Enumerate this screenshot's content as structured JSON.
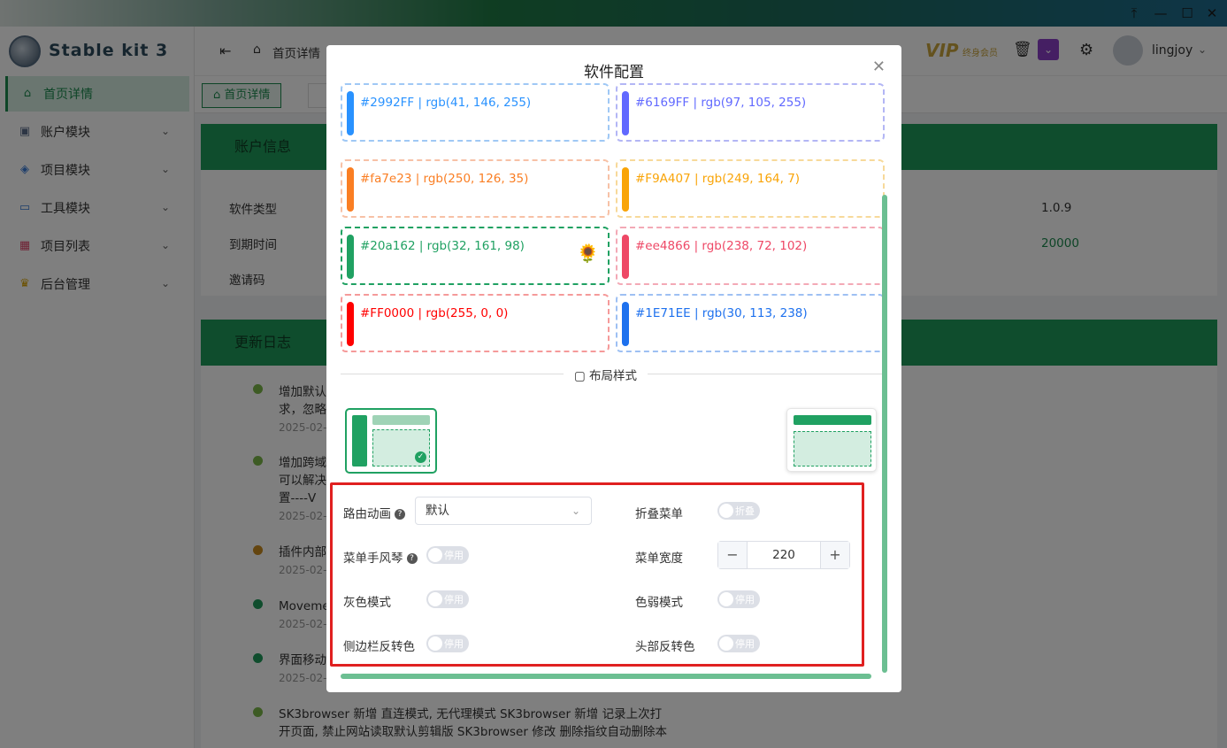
{
  "window": {
    "pin_icon": "pin-icon",
    "minimize_icon": "minimize-icon",
    "maximize_icon": "maximize-icon",
    "close_icon": "close-icon"
  },
  "app": {
    "title": "Stable kit 3"
  },
  "sidebar": {
    "items": [
      {
        "label": "首页详情",
        "icon": "home-icon"
      },
      {
        "label": "账户模块",
        "icon": "user-icon"
      },
      {
        "label": "项目模块",
        "icon": "layers-icon"
      },
      {
        "label": "工具模块",
        "icon": "briefcase-icon"
      },
      {
        "label": "项目列表",
        "icon": "grid-icon"
      },
      {
        "label": "后台管理",
        "icon": "crown-icon"
      }
    ]
  },
  "topbar": {
    "breadcrumb": "首页详情",
    "vip": "VIP",
    "vip_sub": "终身会员",
    "username": "lingjoy"
  },
  "tabs": {
    "home": "首页详情"
  },
  "account_card": {
    "title": "账户信息",
    "rows": [
      {
        "label": "软件类型",
        "value": "1.0.9"
      },
      {
        "label": "到期时间",
        "value": "20000"
      },
      {
        "label": "邀请码",
        "value": ""
      }
    ]
  },
  "changelog": {
    "title": "更新日志",
    "entries": [
      {
        "text": "增加默认",
        "text2": "求，忽略",
        "date": "2025-02-"
      },
      {
        "text": "增加跨域",
        "text2": "可以解决",
        "text3": "置----V",
        "date": "2025-02-"
      },
      {
        "text": "插件内部",
        "date": "2025-02-"
      },
      {
        "text": "Moveme",
        "date": "2025-02-"
      },
      {
        "text": "界面移动",
        "date": "2025-02-"
      },
      {
        "text": "SK3browser 新增 直连模式, 无代理模式 SK3browser 新增 记录上次打",
        "text2": "开页面, 禁止网站读取默认剪辑版 SK3browser 修改 删除指纹自动删除本"
      }
    ]
  },
  "modal": {
    "title": "软件配置",
    "colors": [
      {
        "label": "#2992FF | rgb(41, 146, 255)",
        "color": "#2992FF"
      },
      {
        "label": "#6169FF | rgb(97, 105, 255)",
        "color": "#6169FF"
      },
      {
        "label": "#fa7e23 | rgb(250, 126, 35)",
        "color": "#fa7e23"
      },
      {
        "label": "#F9A407 | rgb(249, 164, 7)",
        "color": "#F9A407"
      },
      {
        "label": "#20a162 | rgb(32, 161, 98)",
        "color": "#20a162",
        "selected": true
      },
      {
        "label": "#ee4866 | rgb(238, 72, 102)",
        "color": "#ee4866"
      },
      {
        "label": "#FF0000 | rgb(255, 0, 0)",
        "color": "#FF0000"
      },
      {
        "label": "#1E71EE | rgb(30, 113, 238)",
        "color": "#1E71EE"
      }
    ],
    "layout_title": "布局样式",
    "settings": {
      "route_anim_label": "路由动画",
      "route_anim_value": "默认",
      "collapse_label": "折叠菜单",
      "collapse_state": "折叠",
      "accordion_label": "菜单手风琴",
      "accordion_state": "停用",
      "menu_width_label": "菜单宽度",
      "menu_width_value": "220",
      "gray_label": "灰色模式",
      "gray_state": "停用",
      "weak_label": "色弱模式",
      "weak_state": "停用",
      "sidebar_invert_label": "侧边栏反转色",
      "sidebar_invert_state": "停用",
      "header_invert_label": "头部反转色",
      "header_invert_state": "停用"
    }
  }
}
